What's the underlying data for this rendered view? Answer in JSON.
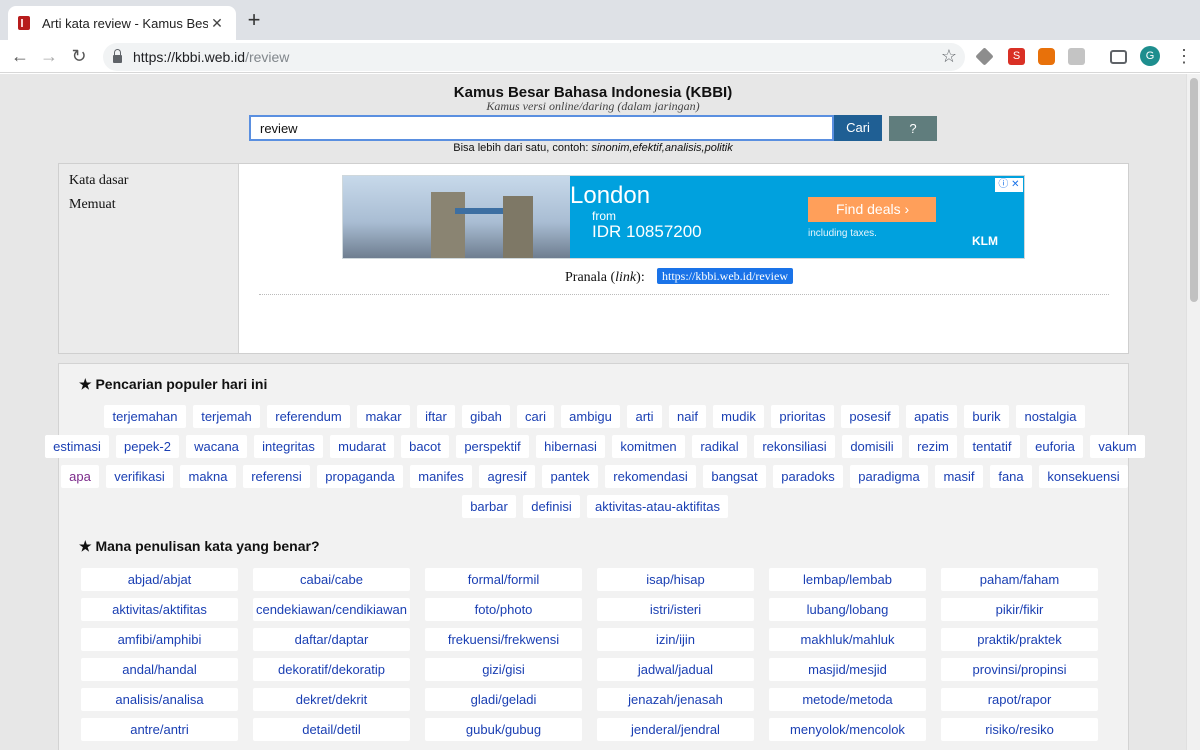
{
  "browser": {
    "tab_title": "Arti kata review - Kamus Besar",
    "tab_close": "✕",
    "new_tab": "+",
    "url_host": "https://kbbi.web.id",
    "url_path": "/review",
    "avatar_letter": "G",
    "ext_s": "S"
  },
  "page": {
    "title": "Kamus Besar Bahasa Indonesia (KBBI)",
    "subtitle": "Kamus versi online/daring (dalam jaringan)",
    "search_value": "review",
    "search_button": "Cari",
    "help_button": "?",
    "hint_prefix": "Bisa lebih dari satu, contoh: ",
    "hint_example": "sinonim,efektif,analisis,politik"
  },
  "sidebar": {
    "items": [
      "Kata dasar",
      "Memuat"
    ]
  },
  "ad": {
    "city": "London",
    "from": "from",
    "price": "IDR 10857200",
    "cta": "Find deals",
    "taxes": "including taxes.",
    "logo": "KLM",
    "info": "ⓘ ✕"
  },
  "pranala": {
    "label_prefix": "Pranala (",
    "label_italic": "link",
    "label_suffix": "):",
    "url": "https://kbbi.web.id/review"
  },
  "popular": {
    "title": "★ Pencarian populer hari ini",
    "rows": [
      [
        "terjemahan",
        "terjemah",
        "referendum",
        "makar",
        "iftar",
        "gibah",
        "cari",
        "ambigu",
        "arti",
        "naif",
        "mudik",
        "prioritas",
        "posesif",
        "apatis",
        "burik",
        "nostalgia"
      ],
      [
        "estimasi",
        "pepek-2",
        "wacana",
        "integritas",
        "mudarat",
        "bacot",
        "perspektif",
        "hibernasi",
        "komitmen",
        "radikal",
        "rekonsiliasi",
        "domisili",
        "rezim",
        "tentatif",
        "euforia",
        "vakum"
      ],
      [
        "apa",
        "verifikasi",
        "makna",
        "referensi",
        "propaganda",
        "manifes",
        "agresif",
        "pantek",
        "rekomendasi",
        "bangsat",
        "paradoks",
        "paradigma",
        "masif",
        "fana",
        "konsekuensi"
      ],
      [
        "barbar",
        "definisi",
        "aktivitas-atau-aktifitas"
      ]
    ]
  },
  "spelling": {
    "title": "★ Mana penulisan kata yang benar?",
    "columns": [
      [
        "abjad/abjat",
        "aktivitas/aktifitas",
        "amfibi/amphibi",
        "andal/handal",
        "analisis/analisa",
        "antre/antri"
      ],
      [
        "cabai/cabe",
        "cendekiawan/cendikiawan",
        "daftar/daptar",
        "dekoratif/dekoratip",
        "dekret/dekrit",
        "detail/detil"
      ],
      [
        "formal/formil",
        "foto/photo",
        "frekuensi/frekwensi",
        "gizi/gisi",
        "gladi/geladi",
        "gubuk/gubug"
      ],
      [
        "isap/hisap",
        "istri/isteri",
        "izin/ijin",
        "jadwal/jadual",
        "jenazah/jenasah",
        "jenderal/jendral"
      ],
      [
        "lembap/lembab",
        "lubang/lobang",
        "makhluk/mahluk",
        "masjid/mesjid",
        "metode/metoda",
        "menyolok/mencolok"
      ],
      [
        "paham/faham",
        "pikir/fikir",
        "praktik/praktek",
        "provinsi/propinsi",
        "rapot/rapor",
        "risiko/resiko"
      ]
    ]
  }
}
